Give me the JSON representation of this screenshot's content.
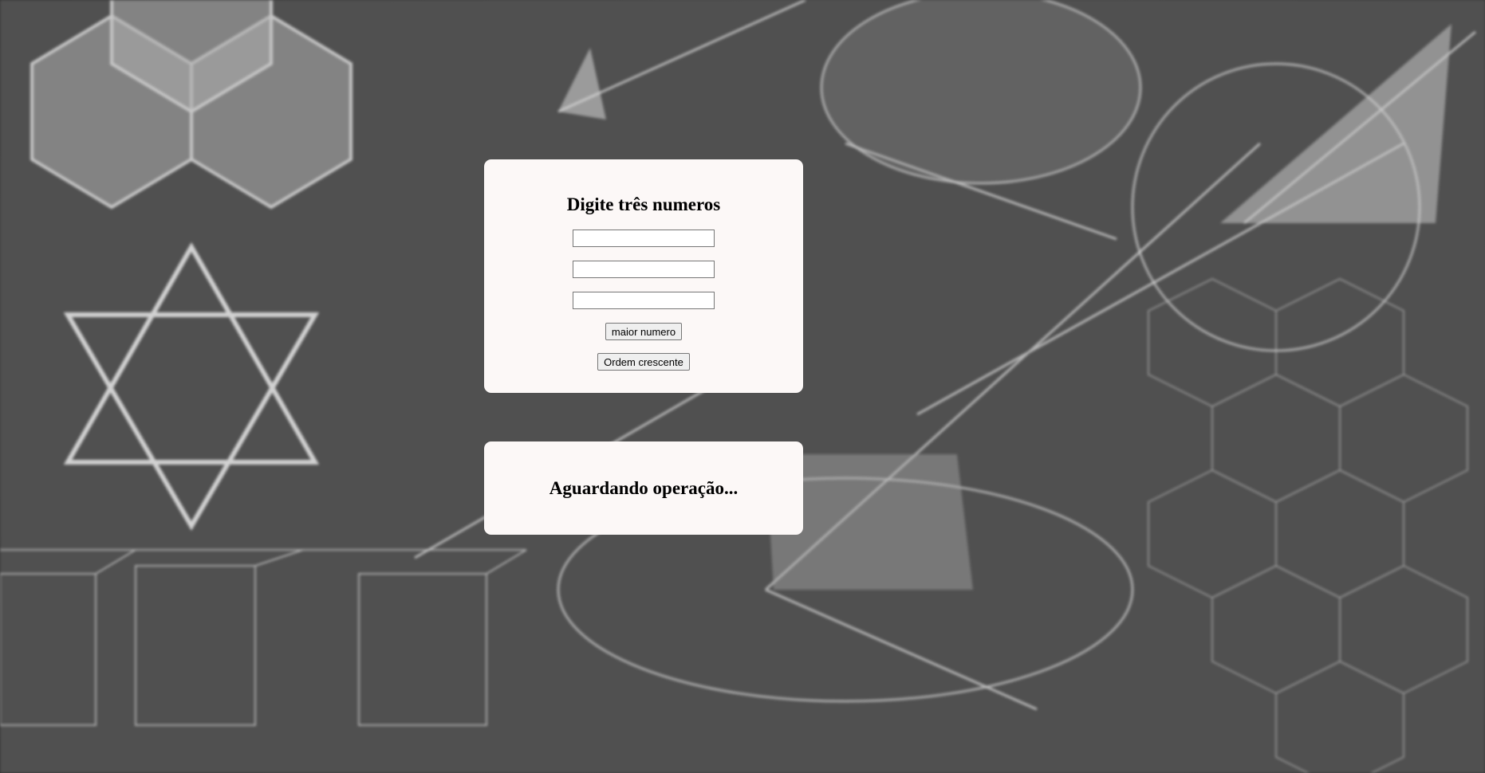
{
  "form": {
    "title": "Digite três numeros",
    "inputs": [
      {
        "value": "",
        "placeholder": ""
      },
      {
        "value": "",
        "placeholder": ""
      },
      {
        "value": "",
        "placeholder": ""
      }
    ],
    "max_button_label": "maior numero",
    "sort_button_label": "Ordem crescente"
  },
  "result": {
    "status_text": "Aguardando operação..."
  },
  "background": {
    "description_icon": "chalkboard-geometry-background",
    "colors": {
      "base": "#4a4a4a",
      "chalk": "#e6e6e6",
      "card": "#fcf8f7"
    }
  }
}
